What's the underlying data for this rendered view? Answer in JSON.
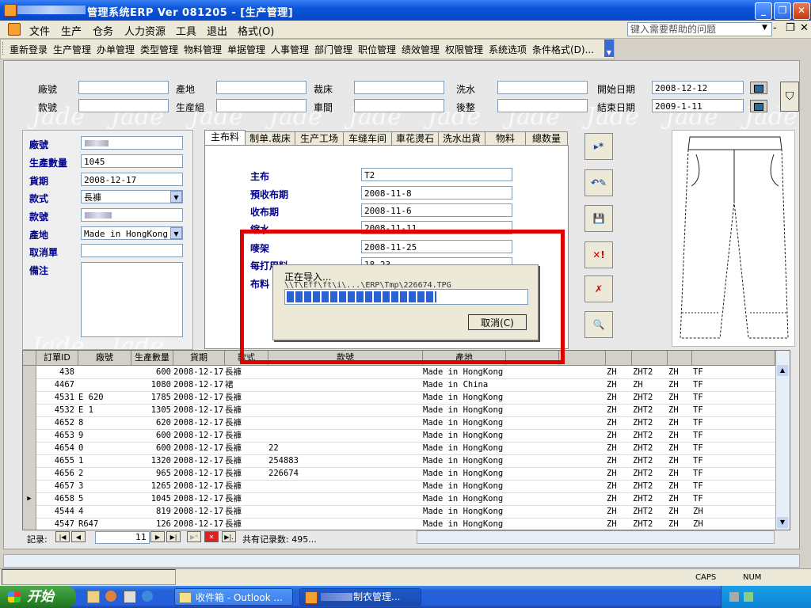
{
  "window": {
    "title": "管理系统ERP Ver 081205 - [生产管理]",
    "min": "_",
    "max": "❐",
    "close": "✕"
  },
  "menubar": {
    "items": [
      "文件",
      "生产",
      "仓务",
      "人力资源",
      "工具",
      "退出",
      "格式(O)"
    ],
    "help_placeholder": "键入需要帮助的问题",
    "controls": [
      "-",
      "❐",
      "✕"
    ]
  },
  "toolbar": {
    "items": [
      "重新登录",
      "生产管理",
      "办单管理",
      "类型管理",
      "物料管理",
      "单据管理",
      "人事管理",
      "部门管理",
      "职位管理",
      "绩效管理",
      "权限管理",
      "系统选项",
      "条件格式(D)..."
    ]
  },
  "filter": {
    "labels": [
      "廠號",
      "產地",
      "裁床",
      "洗水",
      "開始日期",
      "款號",
      "生産組",
      "車間",
      "後整",
      "結束日期"
    ],
    "start_date": "2008-12-12",
    "end_date": "2009-1-11"
  },
  "left_form": {
    "labels": [
      "廠號",
      "生產數量",
      "貨期",
      "款式",
      "款號",
      "產地",
      "取消單",
      "備注"
    ],
    "qty": "1045",
    "date": "2008-12-17",
    "style": "長褲",
    "origin": "Made in HongKong"
  },
  "tabs": [
    "主布料",
    "制单.裁床",
    "生产工场",
    "车缝车间",
    "車花燙石",
    "洗水出貨",
    "物料",
    "總数量"
  ],
  "main_form": {
    "labels": [
      "主布",
      "預收布期",
      "收布期",
      "縮水",
      "嘜架",
      "每打用料",
      "布料"
    ],
    "values": [
      "T2",
      "2008-11-8",
      "2008-11-6",
      "2008-11-11",
      "2008-11-25",
      "18.23",
      ""
    ]
  },
  "dialog": {
    "title": "正在导入...",
    "path": "\\\\T\\Eff\\ft\\i\\...\\ERP\\Tmp\\226674.TPG",
    "progress": 0.63,
    "cancel": "取消(C)"
  },
  "grid": {
    "headers": [
      "訂單ID",
      "廠號",
      "生產數量",
      "貨期",
      "款式",
      "款號",
      "產地",
      "",
      "",
      "",
      "",
      "",
      "",
      ""
    ],
    "rows": [
      {
        "id": "438",
        "f": "",
        "qty": "600",
        "date": "2008-12-17",
        "style": "長褲",
        "no": "",
        "origin": "Made in HongKong",
        "a": "ZH",
        "b": "ZHT2",
        "c": "ZH",
        "d": "TF",
        "sel": false
      },
      {
        "id": "4467",
        "f": "",
        "qty": "1080",
        "date": "2008-12-17",
        "style": "裙",
        "no": "",
        "origin": "Made in China",
        "a": "ZH",
        "b": "ZH",
        "c": "ZH",
        "d": "TF",
        "sel": false
      },
      {
        "id": "4531",
        "f": "E 620",
        "qty": "1785",
        "date": "2008-12-17",
        "style": "長褲",
        "no": "",
        "origin": "Made in HongKong",
        "a": "ZH",
        "b": "ZHT2",
        "c": "ZH",
        "d": "TF",
        "sel": false
      },
      {
        "id": "4532",
        "f": "E 1",
        "qty": "1305",
        "date": "2008-12-17",
        "style": "長褲",
        "no": "",
        "origin": "Made in HongKong",
        "a": "ZH",
        "b": "ZHT2",
        "c": "ZH",
        "d": "TF",
        "sel": false
      },
      {
        "id": "4652",
        "f": "8",
        "qty": "620",
        "date": "2008-12-17",
        "style": "長褲",
        "no": "",
        "origin": "Made in HongKong",
        "a": "ZH",
        "b": "ZHT2",
        "c": "ZH",
        "d": "TF",
        "sel": false
      },
      {
        "id": "4653",
        "f": "9",
        "qty": "600",
        "date": "2008-12-17",
        "style": "長褲",
        "no": "",
        "origin": "Made in HongKong",
        "a": "ZH",
        "b": "ZHT2",
        "c": "ZH",
        "d": "TF",
        "sel": false
      },
      {
        "id": "4654",
        "f": "0",
        "qty": "600",
        "date": "2008-12-17",
        "style": "長褲",
        "no": "22",
        "origin": "Made in HongKong",
        "a": "ZH",
        "b": "ZHT2",
        "c": "ZH",
        "d": "TF",
        "sel": false
      },
      {
        "id": "4655",
        "f": "1",
        "qty": "1320",
        "date": "2008-12-17",
        "style": "長褲",
        "no": "254883",
        "origin": "Made in HongKong",
        "a": "ZH",
        "b": "ZHT2",
        "c": "ZH",
        "d": "TF",
        "sel": false
      },
      {
        "id": "4656",
        "f": "2",
        "qty": "965",
        "date": "2008-12-17",
        "style": "長褲",
        "no": "226674",
        "origin": "Made in HongKong",
        "a": "ZH",
        "b": "ZHT2",
        "c": "ZH",
        "d": "TF",
        "sel": false
      },
      {
        "id": "4657",
        "f": "3",
        "qty": "1265",
        "date": "2008-12-17",
        "style": "長褲",
        "no": "",
        "origin": "Made in HongKong",
        "a": "ZH",
        "b": "ZHT2",
        "c": "ZH",
        "d": "TF",
        "sel": false
      },
      {
        "id": "4658",
        "f": "5",
        "qty": "1045",
        "date": "2008-12-17",
        "style": "長褲",
        "no": "",
        "origin": "Made in HongKong",
        "a": "ZH",
        "b": "ZHT2",
        "c": "ZH",
        "d": "TF",
        "sel": true
      },
      {
        "id": "4544",
        "f": "4",
        "qty": "819",
        "date": "2008-12-17",
        "style": "長褲",
        "no": "",
        "origin": "Made in HongKong",
        "a": "ZH",
        "b": "ZHT2",
        "c": "ZH",
        "d": "ZH",
        "sel": false
      },
      {
        "id": "4547",
        "f": "R647",
        "qty": "126",
        "date": "2008-12-17",
        "style": "長褲",
        "no": "",
        "origin": "Made in HongKong",
        "a": "ZH",
        "b": "ZHT2",
        "c": "ZH",
        "d": "ZH",
        "sel": false
      }
    ]
  },
  "nav": {
    "label": "記录:",
    "current": "11",
    "total": "共有记录数: 495..."
  },
  "status": {
    "caps": "CAPS",
    "num": "NUM"
  },
  "taskbar": {
    "start": "开始",
    "tasks": [
      "收件箱 - Outlook ...",
      "制衣管理..."
    ],
    "clock": ""
  },
  "watermark": "Jade"
}
